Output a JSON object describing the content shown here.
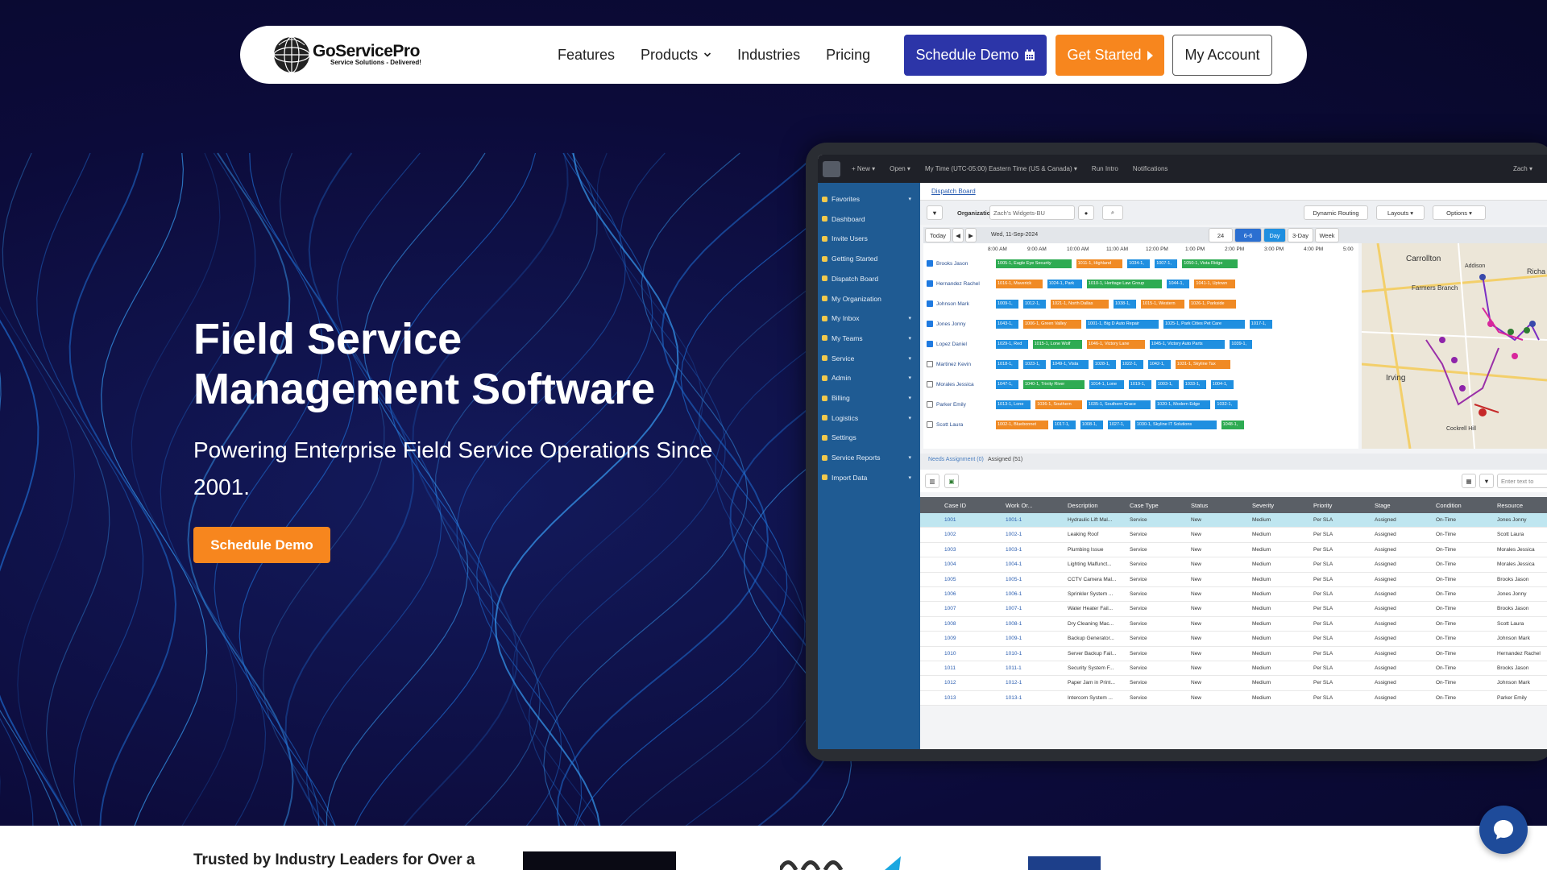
{
  "brand": {
    "name": "GoServicePro",
    "tagline": "Service Solutions - Delivered!"
  },
  "nav": {
    "links": [
      "Features",
      "Products",
      "Industries",
      "Pricing"
    ],
    "schedule_demo": "Schedule Demo",
    "get_started": "Get Started",
    "my_account": "My Account"
  },
  "hero": {
    "title_line1": "Field Service",
    "title_line2": "Management Software",
    "subtitle": "Powering Enterprise Field Service Operations Since 2001.",
    "cta": "Schedule Demo"
  },
  "app": {
    "topbar": [
      "+ New ▾",
      "Open ▾",
      "My Time (UTC-05:00) Eastern Time (US & Canada) ▾",
      "Run Intro",
      "Notifications"
    ],
    "user": "Zach ▾",
    "sidebar": [
      {
        "label": "Favorites",
        "exp": true
      },
      {
        "label": "Dashboard",
        "exp": false
      },
      {
        "label": "Invite Users",
        "exp": false
      },
      {
        "label": "Getting Started",
        "exp": false
      },
      {
        "label": "Dispatch Board",
        "exp": false
      },
      {
        "label": "My Organization",
        "exp": false
      },
      {
        "label": "My Inbox",
        "exp": true
      },
      {
        "label": "My Teams",
        "exp": true
      },
      {
        "label": "Service",
        "exp": true
      },
      {
        "label": "Admin",
        "exp": true
      },
      {
        "label": "Billing",
        "exp": true
      },
      {
        "label": "Logistics",
        "exp": true
      },
      {
        "label": "Settings",
        "exp": false
      },
      {
        "label": "Service Reports",
        "exp": true
      },
      {
        "label": "Import Data",
        "exp": true
      }
    ],
    "dispatch_title": "Dispatch Board",
    "org_label": "Organization",
    "org_value": "Zach's Widgets-BU",
    "dynamic_routing": "Dynamic Routing",
    "layouts": "Layouts ▾",
    "options": "Options ▾",
    "today": "Today",
    "date": "Wed, 11-Sep-2024",
    "views": [
      "24",
      "6-6",
      "Day",
      "3-Day",
      "Week"
    ],
    "hours": [
      "8:00 AM",
      "9:00 AM",
      "10:00 AM",
      "11:00 AM",
      "12:00 PM",
      "1:00 PM",
      "2:00 PM",
      "3:00 PM",
      "4:00 PM",
      "5:00"
    ],
    "resources": [
      {
        "name": "Brooks Jason",
        "checked": true,
        "jobs": [
          [
            "1005-1, Eagle Eye Security",
            "g"
          ],
          [
            "1011-1, Highland",
            "o"
          ],
          [
            "1034-1,",
            "b"
          ],
          [
            "1007-1,",
            "b"
          ],
          [
            "1050-1, Vista Ridge",
            "g"
          ]
        ]
      },
      {
        "name": "Hernandez Rachel",
        "checked": true,
        "jobs": [
          [
            "1016-1, Maverick",
            "o"
          ],
          [
            "1024-1, Park",
            "b"
          ],
          [
            "1010-1, Heritage Law Group",
            "g"
          ],
          [
            "1044-1,",
            "b"
          ],
          [
            "1041-1, Uptown",
            "o"
          ]
        ]
      },
      {
        "name": "Johnson Mark",
        "checked": true,
        "jobs": [
          [
            "1009-1,",
            "b"
          ],
          [
            "1012-1,",
            "b"
          ],
          [
            "1021-1, North Dallas",
            "o"
          ],
          [
            "1038-1,",
            "b"
          ],
          [
            "1015-1, Western",
            "o"
          ],
          [
            "1026-1, Parkside",
            "o"
          ]
        ]
      },
      {
        "name": "Jones Jonny",
        "checked": true,
        "jobs": [
          [
            "1043-1,",
            "b"
          ],
          [
            "1006-1, Green Valley",
            "o"
          ],
          [
            "1001-1, Big D Auto Repair",
            "b"
          ],
          [
            "1025-1, Park Cities Pet Care",
            "b"
          ],
          [
            "1017-1,",
            "b"
          ]
        ]
      },
      {
        "name": "Lopez Daniel",
        "checked": true,
        "jobs": [
          [
            "1029-1, Red",
            "b"
          ],
          [
            "1015-1, Lone Wolf",
            "g"
          ],
          [
            "1046-1, Victory Lane",
            "o"
          ],
          [
            "1045-1, Victory Auto Parts",
            "b"
          ],
          [
            "1039-1,",
            "b"
          ]
        ]
      },
      {
        "name": "Martinez Kevin",
        "checked": false,
        "jobs": [
          [
            "1018-1,",
            "b"
          ],
          [
            "1023-1,",
            "b"
          ],
          [
            "1049-1, Vista",
            "b"
          ],
          [
            "1028-1,",
            "b"
          ],
          [
            "1022-1,",
            "b"
          ],
          [
            "1042-1,",
            "b"
          ],
          [
            "1031-1, Skyline Tax",
            "o"
          ]
        ]
      },
      {
        "name": "Morales Jessica",
        "checked": false,
        "jobs": [
          [
            "1047-1,",
            "b"
          ],
          [
            "1040-1, Trinity River",
            "g"
          ],
          [
            "1014-1, Lone",
            "b"
          ],
          [
            "1019-1,",
            "b"
          ],
          [
            "1003-1,",
            "b"
          ],
          [
            "1033-1,",
            "b"
          ],
          [
            "1004-1,",
            "b"
          ]
        ]
      },
      {
        "name": "Parker Emily",
        "checked": false,
        "jobs": [
          [
            "1013-1, Lone",
            "b"
          ],
          [
            "1036-1, Southern",
            "o"
          ],
          [
            "1035-1, Southern Grace",
            "b"
          ],
          [
            "1020-1, Modern Edge",
            "b"
          ],
          [
            "1032-1,",
            "b"
          ]
        ]
      },
      {
        "name": "Scott Laura",
        "checked": false,
        "jobs": [
          [
            "1002-1, Bluebonnet",
            "o"
          ],
          [
            "1017-1,",
            "b"
          ],
          [
            "1008-1,",
            "b"
          ],
          [
            "1027-1,",
            "b"
          ],
          [
            "1030-1, Skyline IT Solutions",
            "b"
          ],
          [
            "1048-1,",
            "g"
          ]
        ]
      }
    ],
    "map_labels": [
      "Carrollton",
      "Addison",
      "Richa",
      "Farmers Branch",
      "Irving",
      "Cockrell Hill"
    ],
    "tabs": [
      "Needs Assignment (0)",
      "Assigned (51)"
    ],
    "search_placeholder": "Enter text to",
    "columns": [
      "Case ID",
      "Work Or...",
      "Description",
      "Case Type",
      "Status",
      "Severity",
      "Priority",
      "Stage",
      "Condition",
      "Resource"
    ],
    "rows": [
      [
        "1001",
        "1001-1",
        "Hydraulic Lift Mal...",
        "Service",
        "New",
        "Medium",
        "Per SLA",
        "Assigned",
        "On-Time",
        "Jones Jonny"
      ],
      [
        "1002",
        "1002-1",
        "Leaking Roof",
        "Service",
        "New",
        "Medium",
        "Per SLA",
        "Assigned",
        "On-Time",
        "Scott Laura"
      ],
      [
        "1003",
        "1003-1",
        "Plumbing Issue",
        "Service",
        "New",
        "Medium",
        "Per SLA",
        "Assigned",
        "On-Time",
        "Morales Jessica"
      ],
      [
        "1004",
        "1004-1",
        "Lighting Malfunct...",
        "Service",
        "New",
        "Medium",
        "Per SLA",
        "Assigned",
        "On-Time",
        "Morales Jessica"
      ],
      [
        "1005",
        "1005-1",
        "CCTV Camera Mal...",
        "Service",
        "New",
        "Medium",
        "Per SLA",
        "Assigned",
        "On-Time",
        "Brooks Jason"
      ],
      [
        "1006",
        "1006-1",
        "Sprinkler System ...",
        "Service",
        "New",
        "Medium",
        "Per SLA",
        "Assigned",
        "On-Time",
        "Jones Jonny"
      ],
      [
        "1007",
        "1007-1",
        "Water Heater Fail...",
        "Service",
        "New",
        "Medium",
        "Per SLA",
        "Assigned",
        "On-Time",
        "Brooks Jason"
      ],
      [
        "1008",
        "1008-1",
        "Dry Cleaning Mac...",
        "Service",
        "New",
        "Medium",
        "Per SLA",
        "Assigned",
        "On-Time",
        "Scott Laura"
      ],
      [
        "1009",
        "1009-1",
        "Backup Generator...",
        "Service",
        "New",
        "Medium",
        "Per SLA",
        "Assigned",
        "On-Time",
        "Johnson Mark"
      ],
      [
        "1010",
        "1010-1",
        "Server Backup Fail...",
        "Service",
        "New",
        "Medium",
        "Per SLA",
        "Assigned",
        "On-Time",
        "Hernandez Rachel"
      ],
      [
        "1011",
        "1011-1",
        "Security System F...",
        "Service",
        "New",
        "Medium",
        "Per SLA",
        "Assigned",
        "On-Time",
        "Brooks Jason"
      ],
      [
        "1012",
        "1012-1",
        "Paper Jam in Print...",
        "Service",
        "New",
        "Medium",
        "Per SLA",
        "Assigned",
        "On-Time",
        "Johnson Mark"
      ],
      [
        "1013",
        "1013-1",
        "Intercom System ...",
        "Service",
        "New",
        "Medium",
        "Per SLA",
        "Assigned",
        "On-Time",
        "Parker Emily"
      ]
    ]
  },
  "trusted": "Trusted by Industry Leaders for Over a",
  "colors": {
    "orange": "#f7861e",
    "blue": "#2c35a8",
    "navy": "#0c0b3a",
    "job_green": "#2eab52",
    "job_orange": "#f08a24",
    "job_blue": "#1f8fe0"
  }
}
